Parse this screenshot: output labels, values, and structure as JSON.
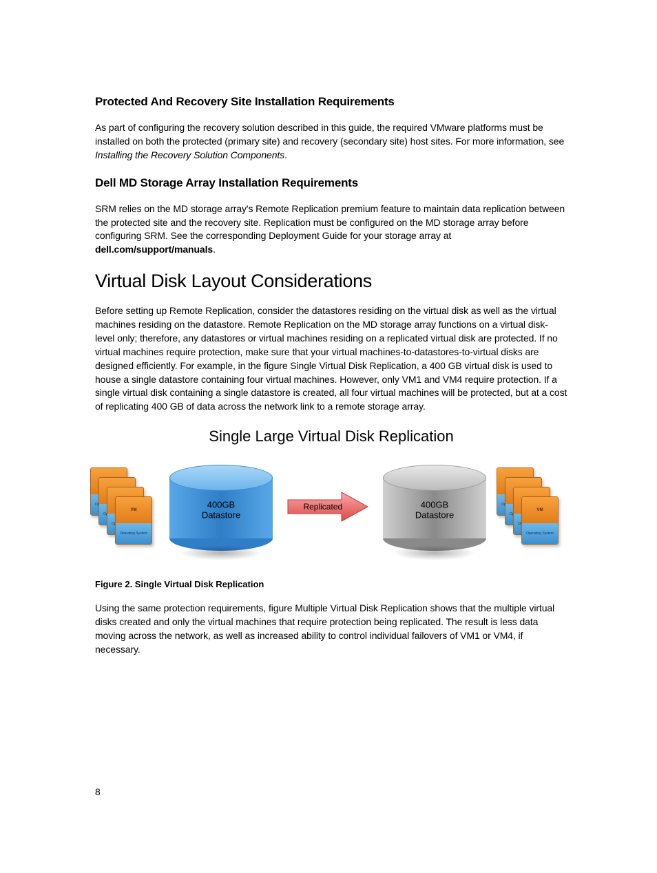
{
  "headings": {
    "h1": "Protected And Recovery Site Installation Requirements",
    "h2": "Dell MD Storage Array Installation Requirements",
    "section": "Virtual Disk Layout Considerations"
  },
  "paragraphs": {
    "p1a": "As part of configuring the recovery solution described in this guide, the required VMware platforms must be installed on both the protected (primary site) and recovery (secondary site) host sites. For more information, see ",
    "p1b_ital": "Installing the Recovery Solution Components",
    "p1c": ".",
    "p2a": "SRM relies on the MD storage array's Remote Replication premium feature to maintain data replication between the protected site and the recovery site. Replication must be configured on the MD storage array before configuring SRM. See the corresponding Deployment Guide for your storage array at ",
    "p2b_bold": "dell.com/support/manuals",
    "p2c": ".",
    "p3": "Before setting up Remote Replication, consider the datastores residing on the virtual disk as well as the virtual machines residing on the datastore. Remote Replication on the MD storage array functions on a virtual disk-level only; therefore, any datastores or virtual machines residing on a replicated virtual disk are protected. If no virtual machines require protection, make sure that your virtual machines-to-datastores-to-virtual disks are designed efficiently. For example, in the figure Single Virtual Disk Replication, a 400 GB virtual disk is used to house a single datastore containing four virtual machines. However, only VM1 and VM4 require protection. If a single virtual disk containing a single datastore is created, all four virtual machines will be protected, but at a cost of replicating 400 GB of data across the network link to a remote storage array.",
    "p4": "Using the same protection requirements, figure Multiple Virtual Disk Replication shows that the multiple virtual disks created and only the virtual machines that require protection being replicated. The result is less data moving across the network, as well as increased ability to control individual failovers of VM1 or VM4, if necessary."
  },
  "figure": {
    "title": "Single Large Virtual Disk Replication",
    "caption": "Figure 2. Single Virtual Disk Replication",
    "left_disk_line1": "400GB",
    "left_disk_line2": "Datastore",
    "right_disk_line1": "400GB",
    "right_disk_line2": "Datastore",
    "arrow_label": "Replicated",
    "vm_top": "VM",
    "vm_bot": "Operating System"
  },
  "page_number": "8"
}
